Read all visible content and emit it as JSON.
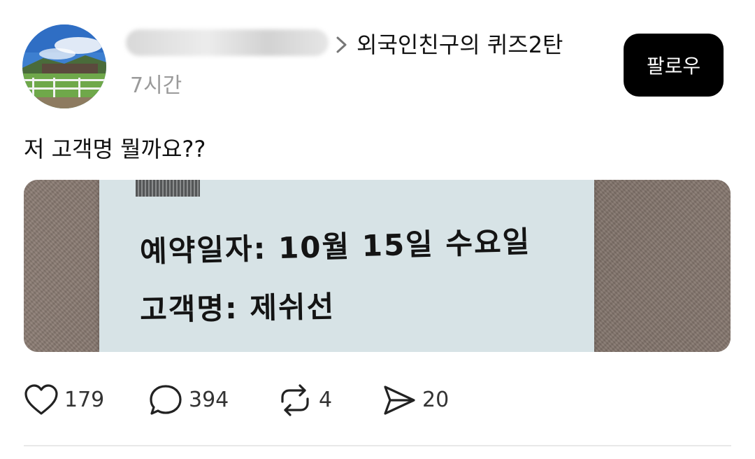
{
  "post": {
    "topic_label": "외국인친구의 퀴즈2탄",
    "time_label": "7시간",
    "follow_label": "팔로우",
    "text": "저 고객명 뭘까요??"
  },
  "photo": {
    "handwritten_line1": "예약일자: 10월 15일 수요일",
    "handwritten_line2": "고객명: 제쉬선"
  },
  "actions": {
    "like_count": "179",
    "comment_count": "394",
    "repost_count": "4",
    "share_count": "20"
  },
  "icons": {
    "chevron": "chevron-right-icon",
    "like": "heart-icon",
    "comment": "comment-bubble-icon",
    "repost": "repost-arrows-icon",
    "share": "send-icon"
  }
}
